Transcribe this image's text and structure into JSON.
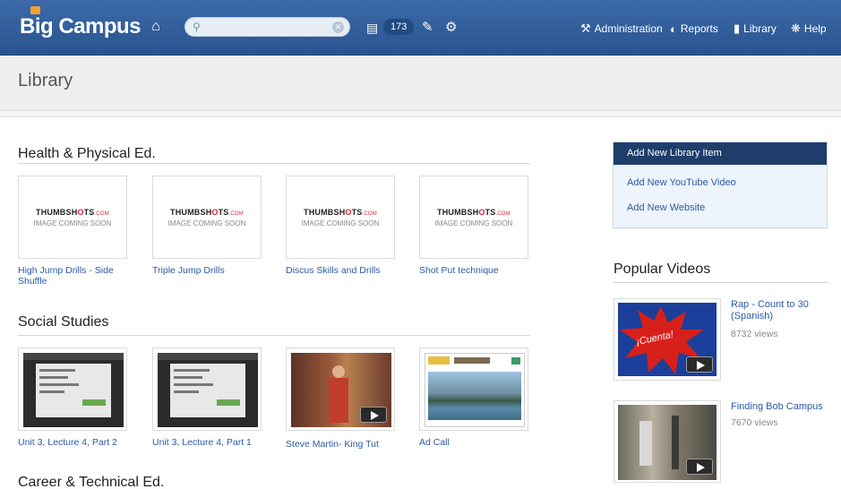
{
  "header": {
    "logo_text": "Big Campus",
    "search_placeholder": "",
    "message_count": "173",
    "nav": [
      {
        "label": "Administration",
        "icon": "wrench-icon"
      },
      {
        "label": "Reports",
        "icon": "pie-chart-icon"
      },
      {
        "label": "Library",
        "icon": "library-icon"
      },
      {
        "label": "Help",
        "icon": "help-icon"
      }
    ]
  },
  "page": {
    "title": "Library"
  },
  "sections": [
    {
      "heading": "Health & Physical Ed.",
      "items": [
        {
          "caption": "High Jump Drills - Side Shuffle",
          "thumb_logo": "THUMBSH",
          "thumb_logo_accent": "O",
          "thumb_logo_tail": "TS",
          "thumb_com": ".COM",
          "thumb_sub": "IMAGE COMING SOON"
        },
        {
          "caption": "Triple Jump Drills",
          "thumb_logo": "THUMBSH",
          "thumb_logo_accent": "O",
          "thumb_logo_tail": "TS",
          "thumb_com": ".COM",
          "thumb_sub": "IMAGE COMING SOON"
        },
        {
          "caption": "Discus Skills and Drills",
          "thumb_logo": "THUMBSH",
          "thumb_logo_accent": "O",
          "thumb_logo_tail": "TS",
          "thumb_com": ".COM",
          "thumb_sub": "IMAGE COMING SOON"
        },
        {
          "caption": "Shot Put technique",
          "thumb_logo": "THUMBSH",
          "thumb_logo_accent": "O",
          "thumb_logo_tail": "TS",
          "thumb_com": ".COM",
          "thumb_sub": "IMAGE COMING SOON"
        }
      ]
    },
    {
      "heading": "Social Studies",
      "items": [
        {
          "caption": "Unit 3, Lecture 4, Part 2"
        },
        {
          "caption": "Unit 3, Lecture 4, Part 1"
        },
        {
          "caption": "Steve Martin- King Tut"
        },
        {
          "caption": "Ad Call"
        }
      ]
    },
    {
      "heading": "Career & Technical Ed.",
      "items": []
    }
  ],
  "sidebar": {
    "actions_header": "Add New Library Item",
    "actions": [
      "Add New YouTube Video",
      "Add New Website"
    ],
    "popular_heading": "Popular Videos",
    "popular": [
      {
        "title": "Rap - Count to 30 (Spanish)",
        "views": "8732 views",
        "thumb_text": "¡Cuenta!"
      },
      {
        "title": "Finding Bob Campus",
        "views": "7670 views"
      }
    ]
  },
  "colors": {
    "header_bg": "#2f5a97",
    "link": "#2a5ba6",
    "panel_header": "#1f3d6b"
  }
}
